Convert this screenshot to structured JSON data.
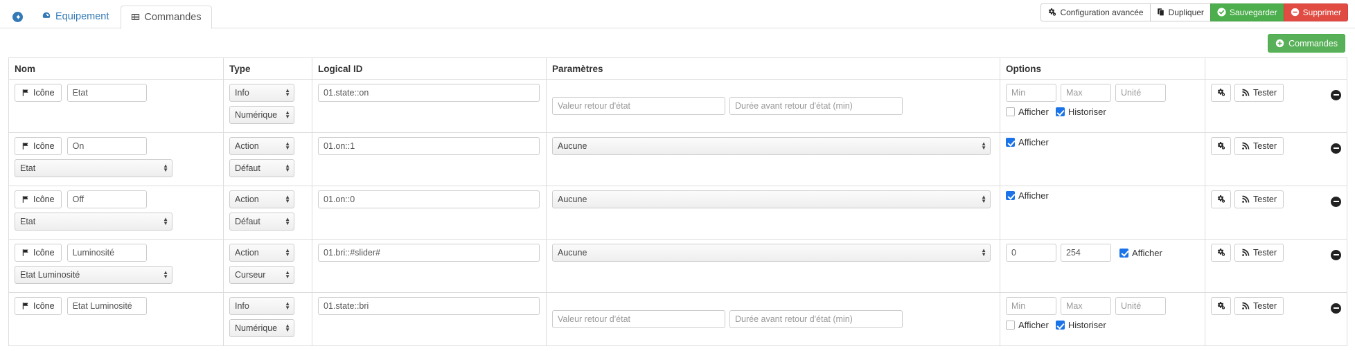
{
  "header": {
    "back_icon": "arrow-circle-left-icon",
    "tabs": [
      {
        "label": "Equipement",
        "icon": "dashboard-icon",
        "active": false
      },
      {
        "label": "Commandes",
        "icon": "table-icon",
        "active": true
      }
    ],
    "actions": [
      {
        "label": "Configuration avancée",
        "icon": "cogs-icon",
        "style": "default"
      },
      {
        "label": "Dupliquer",
        "icon": "copy-icon",
        "style": "default"
      },
      {
        "label": "Sauvegarder",
        "icon": "check-circle-icon",
        "style": "green"
      },
      {
        "label": "Supprimer",
        "icon": "minus-circle-icon",
        "style": "red"
      }
    ]
  },
  "toolbar": {
    "add_label": "Commandes",
    "add_icon": "plus-circle-icon"
  },
  "colors": {
    "primary": "#337ab7",
    "success": "#4cae4c",
    "danger": "#d43f3f",
    "checkbox": "#1a73e8",
    "border": "#dddddd"
  },
  "table": {
    "columns": [
      "Nom",
      "Type",
      "Logical ID",
      "Paramètres",
      "Options",
      ""
    ],
    "common": {
      "icon_button_label": "Icône",
      "icon_button_glyph": "flag-icon",
      "test_button_label": "Tester",
      "test_button_glyph": "rss-icon",
      "config_button_glyph": "cogs-icon",
      "delete_glyph": "minus-circle-icon",
      "show_label": "Afficher",
      "history_label": "Historiser",
      "placeholder_value": "Valeur retour d'état",
      "placeholder_duration": "Durée avant retour d'état (min)",
      "placeholder_min": "Min",
      "placeholder_max": "Max",
      "placeholder_unit": "Unité"
    },
    "rows": [
      {
        "name": "Etat",
        "parent_select": null,
        "type": "Info",
        "subtype": "Numérique",
        "logical_id": "01.state::on",
        "params_kind": "info",
        "param_value": "",
        "param_duration": "",
        "param_select": null,
        "opt_kind": "info",
        "min": "",
        "max": "",
        "unit": "",
        "show_checked": false,
        "history_checked": true
      },
      {
        "name": "On",
        "parent_select": "Etat",
        "type": "Action",
        "subtype": "Défaut",
        "logical_id": "01.on::1",
        "params_kind": "action",
        "param_value": "",
        "param_duration": "",
        "param_select": "Aucune",
        "opt_kind": "action",
        "min": "",
        "max": "",
        "unit": "",
        "show_checked": true,
        "history_checked": false
      },
      {
        "name": "Off",
        "parent_select": "Etat",
        "type": "Action",
        "subtype": "Défaut",
        "logical_id": "01.on::0",
        "params_kind": "action",
        "param_value": "",
        "param_duration": "",
        "param_select": "Aucune",
        "opt_kind": "action",
        "min": "",
        "max": "",
        "unit": "",
        "show_checked": true,
        "history_checked": false
      },
      {
        "name": "Luminosité",
        "parent_select": "Etat Luminosité",
        "type": "Action",
        "subtype": "Curseur",
        "logical_id": "01.bri::#slider#",
        "params_kind": "action",
        "param_value": "",
        "param_duration": "",
        "param_select": "Aucune",
        "opt_kind": "slider",
        "min": "0",
        "max": "254",
        "unit": "",
        "show_checked": true,
        "history_checked": false
      },
      {
        "name": "Etat Luminosité",
        "parent_select": null,
        "type": "Info",
        "subtype": "Numérique",
        "logical_id": "01.state::bri",
        "params_kind": "info",
        "param_value": "",
        "param_duration": "",
        "param_select": null,
        "opt_kind": "info",
        "min": "",
        "max": "",
        "unit": "",
        "show_checked": false,
        "history_checked": true
      }
    ]
  }
}
